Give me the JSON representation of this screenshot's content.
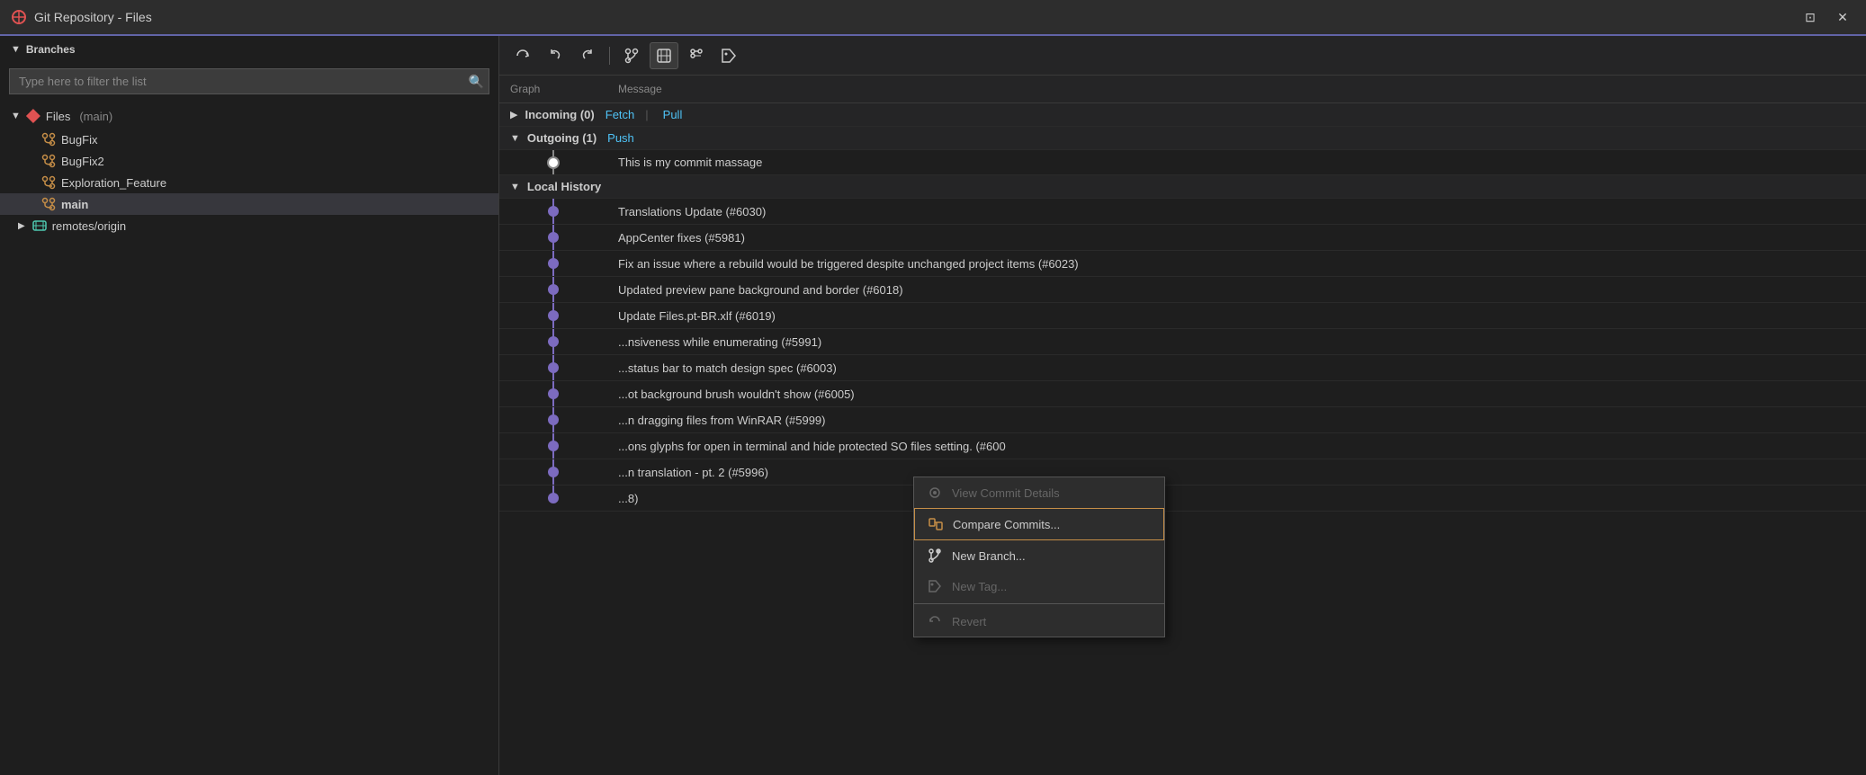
{
  "titleBar": {
    "title": "Git Repository - Files",
    "pinIcon": "📌",
    "closeIcon": "✕"
  },
  "sidebar": {
    "branchesLabel": "Branches",
    "filterPlaceholder": "Type here to filter the list",
    "files": {
      "label": "Files",
      "subLabel": "(main)"
    },
    "branches": [
      {
        "name": "BugFix"
      },
      {
        "name": "BugFix2"
      },
      {
        "name": "Exploration_Feature"
      },
      {
        "name": "main",
        "active": true
      }
    ],
    "remotes": {
      "label": "remotes/origin"
    }
  },
  "toolbar": {
    "buttons": [
      {
        "id": "refresh",
        "icon": "↺",
        "label": "Refresh"
      },
      {
        "id": "undo",
        "icon": "↩",
        "label": "Undo"
      },
      {
        "id": "redo",
        "icon": "↪",
        "label": "Redo"
      },
      {
        "id": "branch",
        "icon": "⑂",
        "label": "Branch"
      },
      {
        "id": "graph1",
        "icon": "⎇",
        "label": "Graph1",
        "active": true
      },
      {
        "id": "graph2",
        "icon": "⎇",
        "label": "Graph2"
      },
      {
        "id": "tag",
        "icon": "◇",
        "label": "Tag"
      }
    ]
  },
  "columns": {
    "graph": "Graph",
    "message": "Message"
  },
  "sections": {
    "incoming": {
      "label": "Incoming (0)",
      "fetch": "Fetch",
      "pull": "Pull"
    },
    "outgoing": {
      "label": "Outgoing (1)",
      "push": "Push"
    },
    "localHistory": {
      "label": "Local History"
    }
  },
  "commits": [
    {
      "id": "outgoing1",
      "message": "This is my commit massage",
      "graphType": "white-dot",
      "section": "outgoing"
    },
    {
      "id": "c1",
      "message": "Translations Update (#6030)",
      "graphType": "dot",
      "section": "local"
    },
    {
      "id": "c2",
      "message": "AppCenter fixes (#5981)",
      "graphType": "dot",
      "section": "local"
    },
    {
      "id": "c3",
      "message": "Fix an issue where a rebuild would be triggered despite unchanged project items (#6023)",
      "graphType": "dot",
      "section": "local"
    },
    {
      "id": "c4",
      "message": "Updated preview pane background and border (#6018)",
      "graphType": "dot",
      "section": "local"
    },
    {
      "id": "c5",
      "message": "Update Files.pt-BR.xlf (#6019)",
      "graphType": "dot",
      "section": "local"
    },
    {
      "id": "c6",
      "message": "...nsiveness while enumerating (#5991)",
      "graphType": "dot",
      "section": "local"
    },
    {
      "id": "c7",
      "message": "...status bar to match design spec (#6003)",
      "graphType": "dot",
      "section": "local"
    },
    {
      "id": "c8",
      "message": "...ot background brush wouldn't show (#6005)",
      "graphType": "dot",
      "section": "local"
    },
    {
      "id": "c9",
      "message": "...n dragging files from WinRAR (#5999)",
      "graphType": "dot",
      "section": "local"
    },
    {
      "id": "c10",
      "message": "...ons glyphs for open in terminal and hide protected SO files setting. (#600",
      "graphType": "dot",
      "section": "local"
    },
    {
      "id": "c11",
      "message": "...n translation - pt. 2 (#5996)",
      "graphType": "dot",
      "section": "local"
    },
    {
      "id": "c12",
      "message": "...8)",
      "graphType": "dot",
      "section": "local"
    }
  ],
  "contextMenu": {
    "items": [
      {
        "id": "view-commit",
        "label": "View Commit Details",
        "icon": "👁",
        "disabled": true
      },
      {
        "id": "compare-commits",
        "label": "Compare Commits...",
        "icon": "📋",
        "highlighted": true
      },
      {
        "id": "new-branch",
        "label": "New Branch...",
        "icon": "⎇"
      },
      {
        "id": "new-tag",
        "label": "New Tag...",
        "icon": "◇",
        "disabled": true
      },
      {
        "id": "revert",
        "label": "Revert",
        "icon": "↩",
        "disabled": true
      }
    ]
  },
  "colors": {
    "accent": "#6264a7",
    "graphLine": "#7c6bbf",
    "linkBlue": "#4fc3f7",
    "activeItem": "#37373d",
    "highlighted": "#c68e47"
  }
}
